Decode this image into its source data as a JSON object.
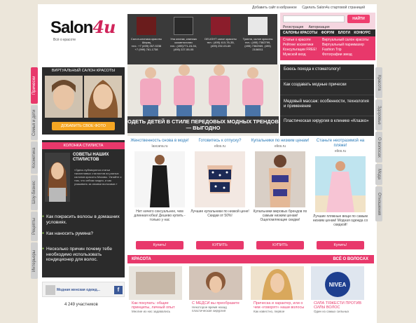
{
  "header": {
    "toplinks": [
      "Добавить сайт в избранное",
      "Сделать Salon4u стартовой страницей"
    ],
    "logo_main": "Salon",
    "logo_accent": "4u",
    "tagline": "Всё о красоте",
    "search_btn": "НАЙТИ",
    "auth": [
      "Регистрация",
      "Авторизация"
    ],
    "menu": [
      "САЛОНЫ КРАСОТЫ",
      "ФОРУМ",
      "БЛОГИ",
      "КОНКУРС"
    ],
    "pink_menu_col1": [
      "Статьи о красоте",
      "Рейтинг косметики",
      "Консультации FREE!",
      "Мужской вход"
    ],
    "pink_menu_col2": [
      "Виртуальный салон красоты",
      "Виртуальный парикмахер",
      "Fashion Trip",
      "Фотографии звезд"
    ]
  },
  "salons": [
    {
      "name": "Салон-клиника красоты Шприц",
      "phone": "тел.: +7 (499) 267-9238",
      "phone2": "+7 (999) 761-1738"
    },
    {
      "name": "Уна клиник, клиника косметологии",
      "phone": "тел.: (495)771-24-94,",
      "phone2": "(495) 227-55-05"
    },
    {
      "name": "DELIGHT салон красоты",
      "phone": "тел.: (495) 410-76-35,",
      "phone2": "(499) 292-03-69"
    },
    {
      "name": "Триеля, салон красоты",
      "phone": "тел.: (495) 7382799,",
      "phone2": "(495) 7382969, (495) 2106511"
    }
  ],
  "left_tabs": [
    "Прически",
    "Семья и дети",
    "Косметика",
    "Шоу-бизнес",
    "Рецепты",
    "Интерьеры"
  ],
  "right_tabs": [
    "Красота",
    "Здоровье",
    "О волосах",
    "Мода",
    "Отношения"
  ],
  "virtual_salon": {
    "title": "ВИРТУАЛЬНЫЙ САЛОН КРАСОТЫ",
    "button": "ДОБАВИТЬ СВОЕ ФОТО"
  },
  "stylist": {
    "title": "КОЛОНКА СТИЛИСТА",
    "heading": "Советы наших стилистов",
    "text": "«Здесь публикуются статьи талантливых стилистов из разных салонов красоты Москвы. Узнайте о том, что сейчас модно, и как ухаживать за своими волосами.»",
    "questions": [
      "Как покрасить волосы в домашних условиях.",
      "Как наносить румяна?",
      "Несколько причин почему тебе необходимо использовать кондиционер для волос."
    ],
    "fb_label": "Модная женская одежд...",
    "members": "4 249 участников"
  },
  "hero": {
    "caption": "Одеть детей в стиле передовых модных трендов — выгодно",
    "list": [
      "Боюсь похода к стоматологу!",
      "Как создавать модные прически",
      "Медовый массаж: особенности, технология и применение",
      "Пластическая хирургия в клинике «Клазко»"
    ]
  },
  "ads": [
    {
      "title": "Женственность снова в моде!",
      "src": "lascana.ru",
      "text": "Нет ничего сексуальнее, чем длинная юбка! Дешево купить - только у нас",
      "button": "Купить!"
    },
    {
      "title": "Готовитесь к отпуску?",
      "src": "elios.ru",
      "text": "Лучшие купальники по низкой цене! Скидки от 50%!",
      "button": "КУПИТЬ"
    },
    {
      "title": "Купальники по низким ценам!",
      "src": "elios.ru",
      "text": "Купальники мировых брендов по самым низким ценам! Ощеломляющие скидки!",
      "button": "КУПИТЬ"
    },
    {
      "title": "Станьте неотразимой на пляже!",
      "src": "elios.ru",
      "text": "Лучшие пляжные вещи по самым низким ценам! Модная одежда со скидкой!",
      "button": "Купить!"
    }
  ],
  "beauty": {
    "label": "КРАСОТА",
    "all_hair": "ВСЁ О ВОЛОСАХ",
    "cards": [
      {
        "title": "Как покупать: общие принципы, личный опыт",
        "sub": "Многие из нас задавались"
      },
      {
        "title": "С МЕДСИ вы преобразите",
        "sub": "Некоторое время назад пластическая хирургия"
      },
      {
        "title": "Прическа и характер, или о чем «говорят» наши волосы",
        "sub": "Как известно, первое"
      },
      {
        "title": "СИЛА ТЯЖЕСТИ ПРОТИВ СИЛЫ ВОЛОС",
        "sub": "Один из самых сильных"
      }
    ]
  }
}
